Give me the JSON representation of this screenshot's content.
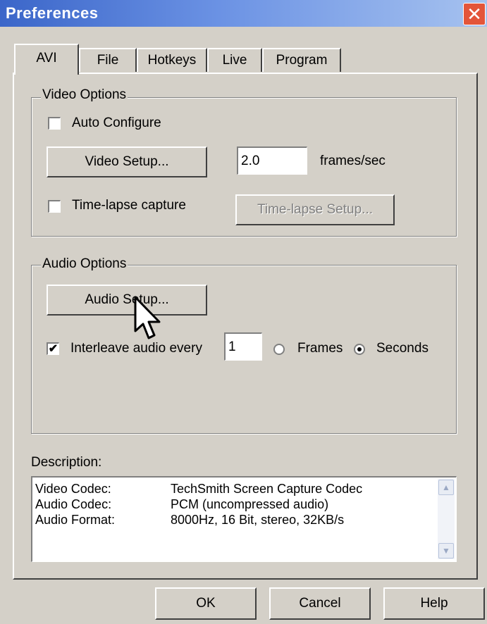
{
  "window": {
    "title": "Preferences",
    "close_glyph": "✕"
  },
  "tabs": [
    {
      "label": "AVI",
      "active": true
    },
    {
      "label": "File",
      "active": false
    },
    {
      "label": "Hotkeys",
      "active": false
    },
    {
      "label": "Live",
      "active": false
    },
    {
      "label": "Program",
      "active": false
    }
  ],
  "video_options": {
    "legend": "Video Options",
    "auto_configure": {
      "label": "Auto Configure",
      "checked": false
    },
    "video_setup_label": "Video Setup...",
    "frame_rate_value": "2.0",
    "frame_rate_unit": "frames/sec",
    "time_lapse": {
      "label": "Time-lapse capture",
      "checked": false
    },
    "time_lapse_setup_label": "Time-lapse Setup..."
  },
  "audio_options": {
    "legend": "Audio Options",
    "audio_setup_label": "Audio Setup...",
    "interleave": {
      "label": "Interleave audio every",
      "checked": true,
      "check_glyph": "✔"
    },
    "interleave_value": "1",
    "unit_frames": "Frames",
    "unit_seconds": "Seconds",
    "selected_unit": "Seconds"
  },
  "description": {
    "label": "Description:",
    "rows": [
      {
        "key": "Video Codec:",
        "value": "TechSmith Screen Capture Codec"
      },
      {
        "key": "Audio Codec:",
        "value": "PCM (uncompressed audio)"
      },
      {
        "key": "Audio Format:",
        "value": "8000Hz, 16 Bit, stereo, 32KB/s"
      }
    ],
    "scroll_up_glyph": "▲",
    "scroll_down_glyph": "▼"
  },
  "footer": {
    "ok_label": "OK",
    "cancel_label": "Cancel",
    "help_label": "Help"
  }
}
